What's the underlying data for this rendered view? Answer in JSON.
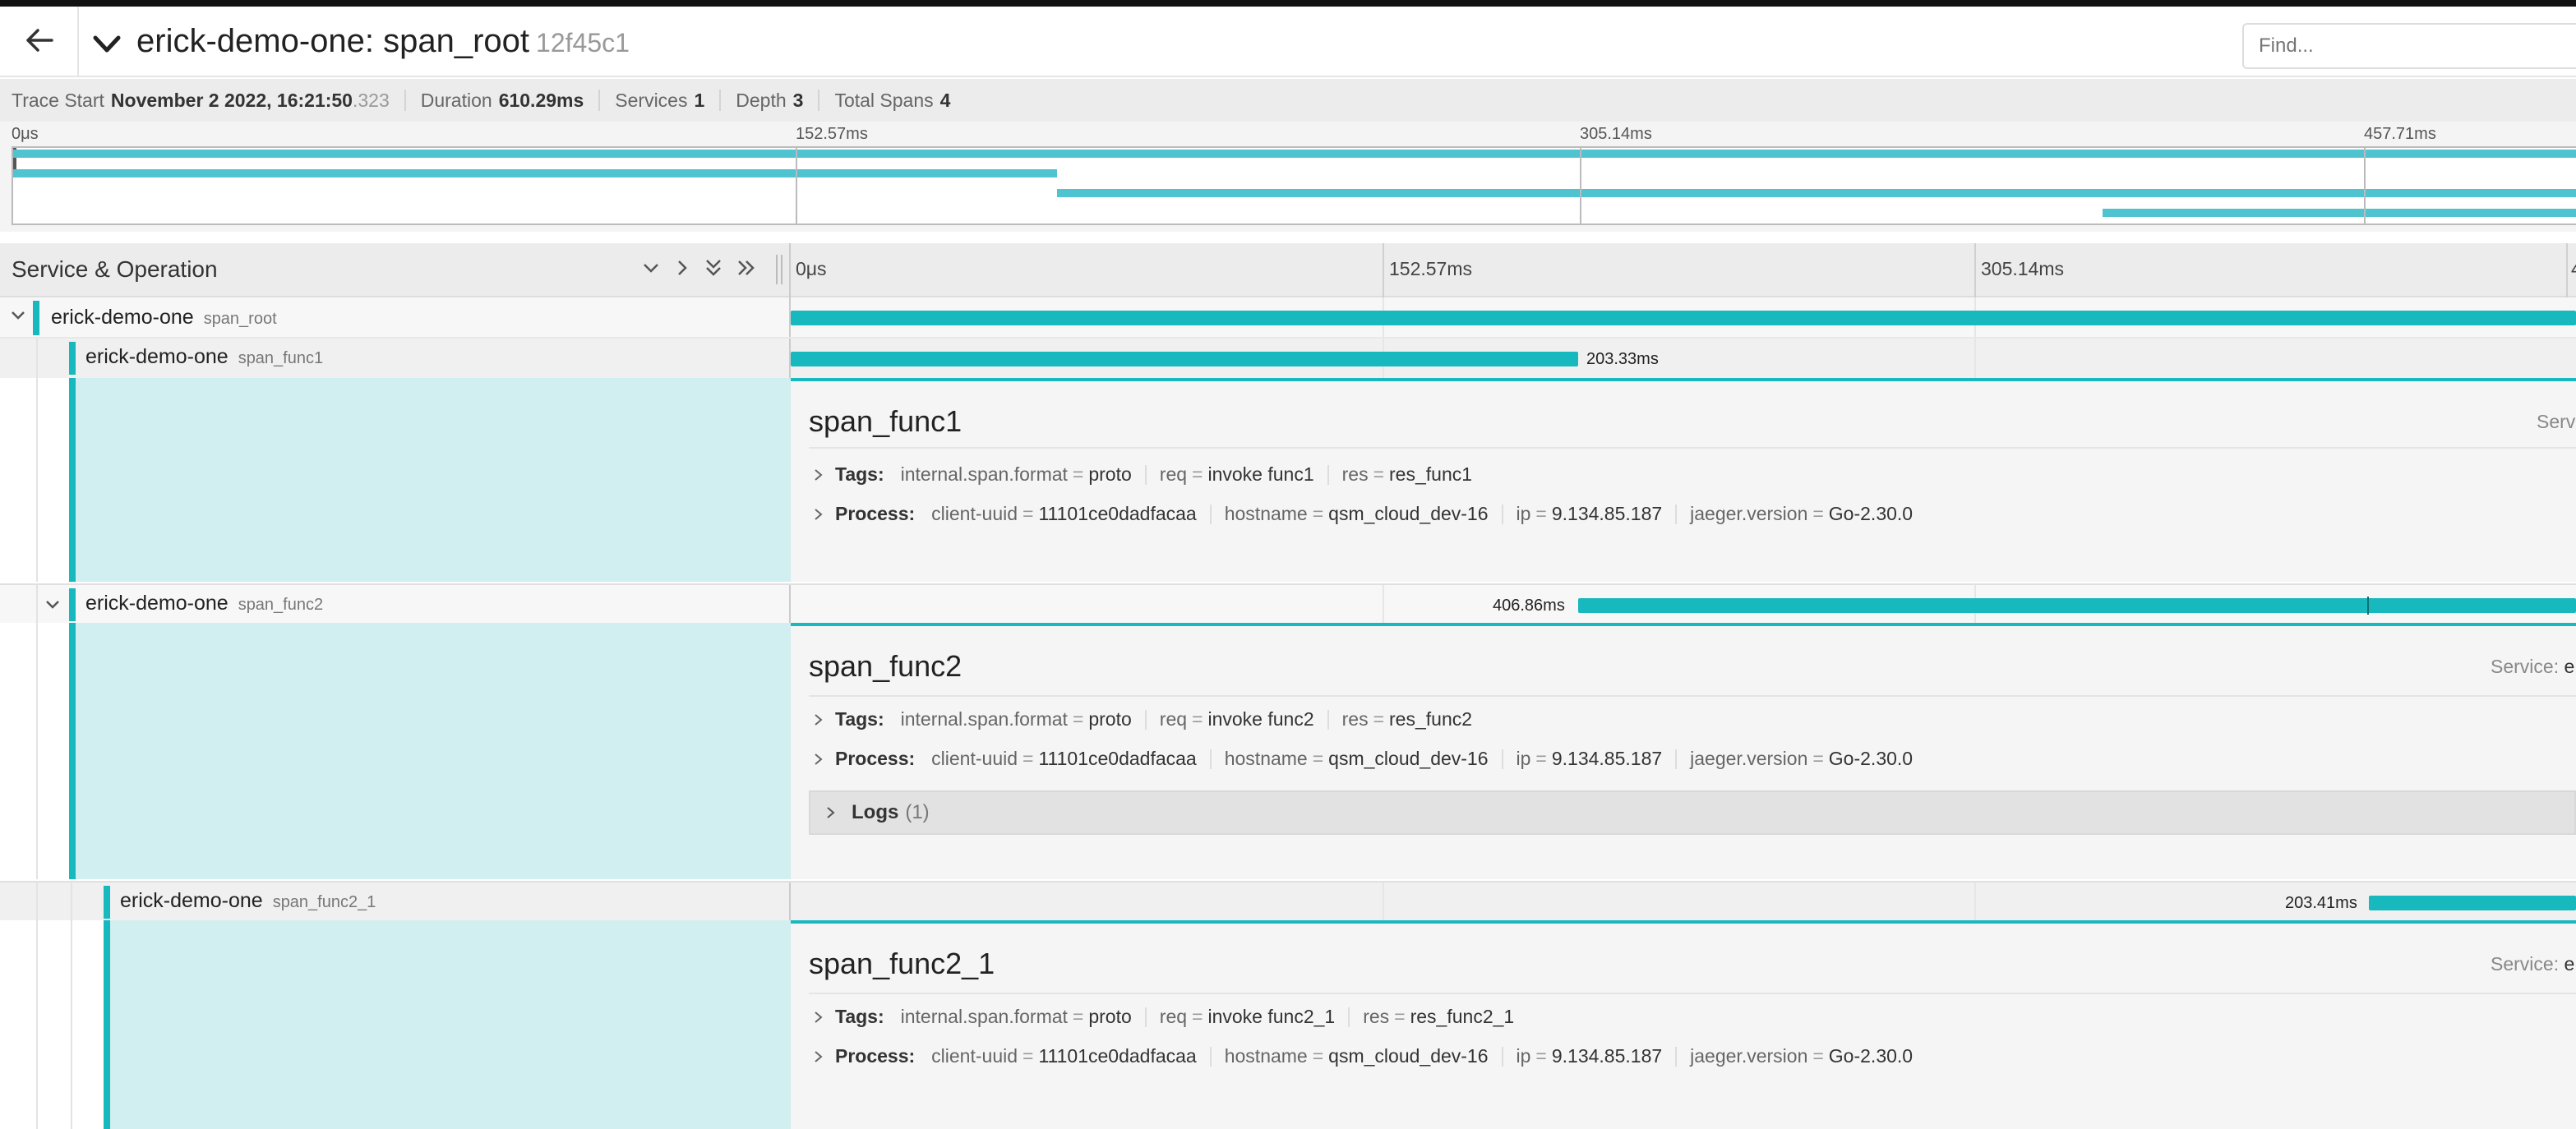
{
  "header": {
    "title": "erick-demo-one: span_root",
    "trace_id": "12f45c1",
    "find_placeholder": "Find..."
  },
  "summary": {
    "trace_start_label": "Trace Start",
    "trace_start_value": "November 2 2022, 16:21:50",
    "trace_start_ms": ".323",
    "duration_label": "Duration",
    "duration_value": "610.29ms",
    "services_label": "Services",
    "services_value": "1",
    "depth_label": "Depth",
    "depth_value": "3",
    "total_spans_label": "Total Spans",
    "total_spans_value": "4"
  },
  "minimap": {
    "ticks": [
      "0μs",
      "152.57ms",
      "305.14ms",
      "457.71ms"
    ]
  },
  "timeline": {
    "column_title": "Service & Operation",
    "ticks": [
      "0μs",
      "152.57ms",
      "305.14ms",
      "4"
    ]
  },
  "spans": [
    {
      "service": "erick-demo-one",
      "operation": "span_root",
      "depth": 0,
      "start_ms": 0,
      "duration_ms": 610.29,
      "duration_label": "",
      "expanded_children": true
    },
    {
      "service": "erick-demo-one",
      "operation": "span_func1",
      "depth": 1,
      "start_ms": 0,
      "duration_ms": 203.33,
      "duration_label": "203.33ms"
    },
    {
      "service": "erick-demo-one",
      "operation": "span_func2",
      "depth": 1,
      "start_ms": 203.33,
      "duration_ms": 406.86,
      "duration_label": "406.86ms",
      "expanded_children": true
    },
    {
      "service": "erick-demo-one",
      "operation": "span_func2_1",
      "depth": 2,
      "start_ms": 406.88,
      "duration_ms": 203.41,
      "duration_label": "203.41ms"
    }
  ],
  "details": {
    "func1": {
      "title": "span_func1",
      "service_label": "Serv",
      "tags_label": "Tags:",
      "tags": [
        {
          "k": "internal.span.format",
          "v": "proto"
        },
        {
          "k": "req",
          "v": "invoke func1"
        },
        {
          "k": "res",
          "v": "res_func1"
        }
      ],
      "process_label": "Process:",
      "process": [
        {
          "k": "client-uuid",
          "v": "11101ce0dadfacaa"
        },
        {
          "k": "hostname",
          "v": "qsm_cloud_dev-16"
        },
        {
          "k": "ip",
          "v": "9.134.85.187"
        },
        {
          "k": "jaeger.version",
          "v": "Go-2.30.0"
        }
      ]
    },
    "func2": {
      "title": "span_func2",
      "service_label": "Service:",
      "service_value": "e",
      "tags_label": "Tags:",
      "tags": [
        {
          "k": "internal.span.format",
          "v": "proto"
        },
        {
          "k": "req",
          "v": "invoke func2"
        },
        {
          "k": "res",
          "v": "res_func2"
        }
      ],
      "process_label": "Process:",
      "process": [
        {
          "k": "client-uuid",
          "v": "11101ce0dadfacaa"
        },
        {
          "k": "hostname",
          "v": "qsm_cloud_dev-16"
        },
        {
          "k": "ip",
          "v": "9.134.85.187"
        },
        {
          "k": "jaeger.version",
          "v": "Go-2.30.0"
        }
      ],
      "logs_label": "Logs",
      "logs_count": "(1)"
    },
    "func2_1": {
      "title": "span_func2_1",
      "service_label": "Service:",
      "service_value": "e",
      "tags_label": "Tags:",
      "tags": [
        {
          "k": "internal.span.format",
          "v": "proto"
        },
        {
          "k": "req",
          "v": "invoke func2_1"
        },
        {
          "k": "res",
          "v": "res_func2_1"
        }
      ],
      "process_label": "Process:",
      "process": [
        {
          "k": "client-uuid",
          "v": "11101ce0dadfacaa"
        },
        {
          "k": "hostname",
          "v": "qsm_cloud_dev-16"
        },
        {
          "k": "ip",
          "v": "9.134.85.187"
        },
        {
          "k": "jaeger.version",
          "v": "Go-2.30.0"
        }
      ]
    }
  },
  "colors": {
    "accent": "#17b8be",
    "accent_light": "#4fc3cf",
    "detail_bg": "#d1eff0"
  }
}
